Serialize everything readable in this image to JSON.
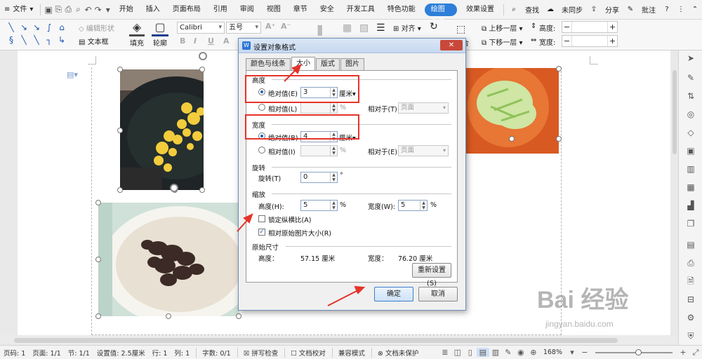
{
  "menubar": {
    "file_label": "文件",
    "tabs": [
      "开始",
      "插入",
      "页面布局",
      "引用",
      "审阅",
      "视图",
      "章节",
      "安全",
      "开发工具",
      "特色功能"
    ],
    "active_tab": "绘图工具",
    "tab_after_active": "效果设置",
    "search_label": "查找",
    "sync_label": "未同步",
    "share_label": "分享",
    "annotate_label": "批注",
    "help_symbol": "?"
  },
  "ribbon": {
    "edit_shape": "编辑形状",
    "textbox": "文本框",
    "fill": "填充",
    "outline": "轮廓",
    "font_name": "Calibri",
    "font_size": "五号",
    "align": "对齐",
    "bring_forward": "上移一层",
    "send_backward": "下移一层",
    "combine": "组合",
    "height_label": "高度:",
    "width_label": "宽度:",
    "height_value": "",
    "width_value": ""
  },
  "dialog": {
    "title": "设置对象格式",
    "close_symbol": "✕",
    "tabs": [
      "颜色与线条",
      "大小",
      "版式",
      "图片"
    ],
    "active_tab_index": 1,
    "height_section": "高度",
    "height_absolute_label": "绝对值(E)",
    "height_absolute_value": "3",
    "height_unit": "厘米",
    "height_relative_label": "相对值(L)",
    "height_relative_unit": "%",
    "height_relative_to_label": "相对于(T)",
    "height_relative_to_value": "页面",
    "width_section": "宽度",
    "width_absolute_label": "绝对值(B)",
    "width_absolute_value": "4",
    "width_unit": "厘米",
    "width_relative_label": "相对值(I)",
    "width_relative_unit": "%",
    "width_relative_to_label": "相对于(E)",
    "width_relative_to_value": "页面",
    "rotation_section": "旋转",
    "rotation_label": "旋转(T)",
    "rotation_value": "0",
    "rotation_unit": "°",
    "scale_section": "缩放",
    "scale_height_label": "高度(H):",
    "scale_height_value": "5",
    "scale_width_label": "宽度(W):",
    "scale_width_value": "5",
    "scale_unit": "%",
    "lock_aspect_label": "锁定纵横比(A)",
    "lock_aspect_checked": false,
    "relative_original_label": "相对原始图片大小(R)",
    "relative_original_checked": true,
    "original_section": "原始尺寸",
    "original_height_label": "高度：",
    "original_height_value": "57.15 厘米",
    "original_width_label": "宽度：",
    "original_width_value": "76.20 厘米",
    "reset_button": "重新设置(S)",
    "ok_button": "确定",
    "cancel_button": "取消"
  },
  "status": {
    "page_code": "页码: 1",
    "page": "页面: 1/1",
    "section": "节: 1/1",
    "setting": "设置值: 2.5厘米",
    "row": "行: 1",
    "col": "列: 1",
    "words": "字数: 0/1",
    "spell": "拼写检查",
    "doc_check": "文档校对",
    "compat": "兼容模式",
    "protect": "文档未保护",
    "zoom": "168%",
    "zoom_fraction": 0.55
  },
  "watermark": {
    "brand": "Bai 经验",
    "url": "jingyan.baidu.com"
  },
  "colors": {
    "accent": "#2d7fd9",
    "annotation_red": "#e5332a"
  }
}
